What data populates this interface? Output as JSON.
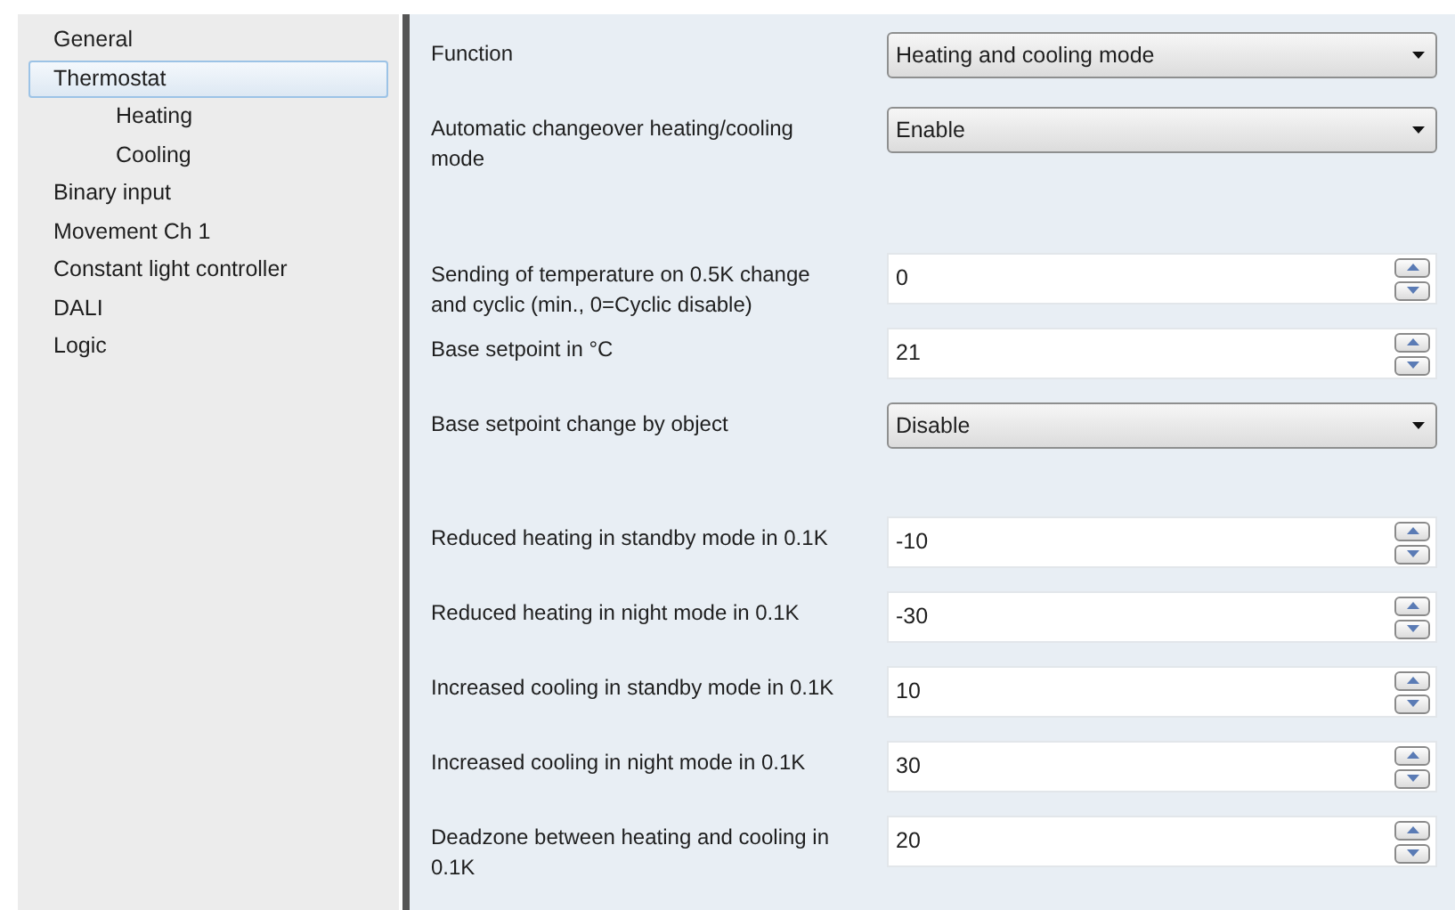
{
  "sidebar": {
    "items": [
      {
        "label": "General",
        "selected": false
      },
      {
        "label": "Thermostat",
        "selected": true,
        "children": [
          {
            "label": "Heating",
            "selected": false
          },
          {
            "label": "Cooling",
            "selected": false
          }
        ]
      },
      {
        "label": "Binary input",
        "selected": false
      },
      {
        "label": "Movement Ch 1",
        "selected": false
      },
      {
        "label": "Constant light controller",
        "selected": false
      },
      {
        "label": "DALI",
        "selected": false
      },
      {
        "label": "Logic",
        "selected": false
      }
    ]
  },
  "sections": [
    [
      {
        "kind": "select",
        "label": "Function",
        "value": "Heating and cooling mode"
      },
      {
        "kind": "select",
        "label": "Automatic changeover heating/cooling mode",
        "value": "Enable"
      }
    ],
    [
      {
        "kind": "spin",
        "label": "Sending of temperature on 0.5K change and cyclic (min., 0=Cyclic disable)",
        "value": "0"
      },
      {
        "kind": "spin",
        "label": "Base setpoint in °C",
        "value": "21"
      },
      {
        "kind": "select",
        "label": "Base setpoint change by object",
        "value": "Disable"
      }
    ],
    [
      {
        "kind": "spin",
        "label": "Reduced heating in standby mode in 0.1K",
        "value": "-10"
      },
      {
        "kind": "spin",
        "label": "Reduced heating in night mode in 0.1K",
        "value": "-30"
      },
      {
        "kind": "spin",
        "label": "Increased cooling in standby mode in 0.1K",
        "value": "10"
      },
      {
        "kind": "spin",
        "label": "Increased cooling in night mode in 0.1K",
        "value": "30"
      },
      {
        "kind": "spin",
        "label": "Deadzone between heating and cooling in 0.1K",
        "value": "20"
      }
    ]
  ]
}
